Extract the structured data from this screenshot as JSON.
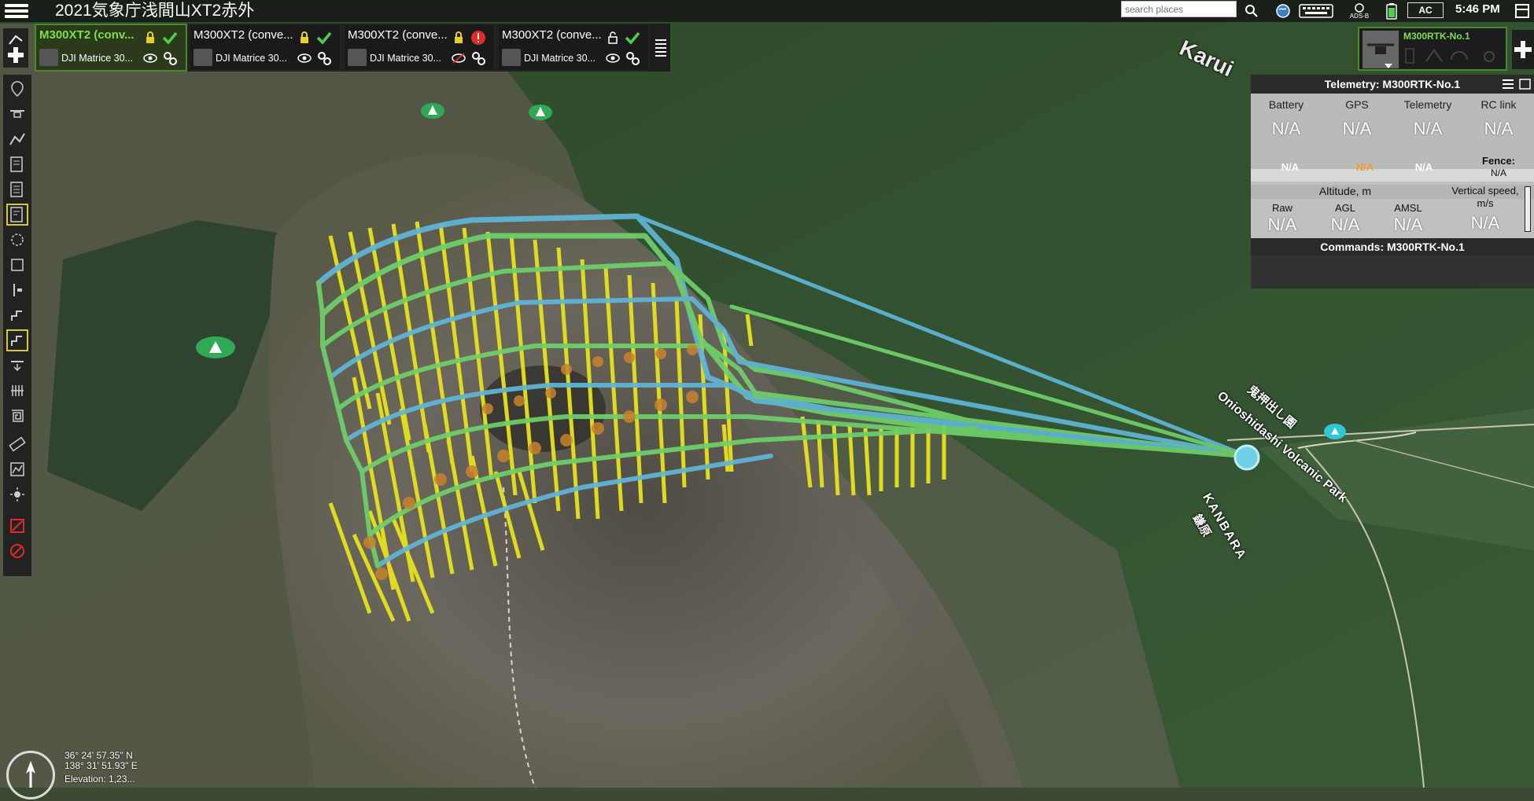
{
  "app": {
    "title": "2021気象庁浅間山XT2赤外",
    "clock": "5:46 PM",
    "ac_label": "AC",
    "ads_label": "ADS-B"
  },
  "search": {
    "placeholder": "search places"
  },
  "drones": [
    {
      "name": "M300XT2 (conv...",
      "model": "DJI Matrice 30...",
      "status": "ok",
      "locked": true,
      "active": true
    },
    {
      "name": "M300XT2 (conve...",
      "model": "DJI Matrice 30...",
      "status": "ok",
      "locked": true,
      "active": false
    },
    {
      "name": "M300XT2 (conve...",
      "model": "DJI Matrice 30...",
      "status": "error",
      "locked": true,
      "active": false
    },
    {
      "name": "M300XT2 (conve...",
      "model": "DJI Matrice 30...",
      "status": "ok",
      "locked": false,
      "active": false
    }
  ],
  "selected_drone": {
    "name": "M300RTK-No.1"
  },
  "telemetry": {
    "title": "Telemetry: M300RTK-No.1",
    "headers": [
      "Battery",
      "GPS",
      "Telemetry",
      "RC link"
    ],
    "values": [
      "N/A",
      "N/A",
      "N/A",
      "N/A"
    ],
    "sub_values": [
      "N/A",
      "N/A",
      "N/A"
    ],
    "fence_label": "Fence:",
    "fence_value": "N/A",
    "altitude_label": "Altitude, m",
    "vspeed_label": "Vertical speed, m/s",
    "alt_headers": [
      "Raw",
      "AGL",
      "AMSL"
    ],
    "alt_values": [
      "N/A",
      "N/A",
      "N/A"
    ],
    "vspeed_value": "N/A"
  },
  "commands": {
    "title": "Commands: M300RTK-No.1"
  },
  "map_labels": {
    "park": "Onioshidashi Volcanic Park",
    "park_jp": "鬼押出し園",
    "kanbara": "KANBARA",
    "kanbara_jp": "鎌原",
    "karui": "Karui"
  },
  "coordinates": {
    "lat": "36° 24' 57.35\" N",
    "lon": "138° 31' 51.93\" E",
    "elevation": "Elevation: 1,23..."
  },
  "colors": {
    "accent": "#7be04a",
    "path": "#6fd06a",
    "path_blue": "#5fb6d8",
    "pillar": "#e7e21c"
  }
}
